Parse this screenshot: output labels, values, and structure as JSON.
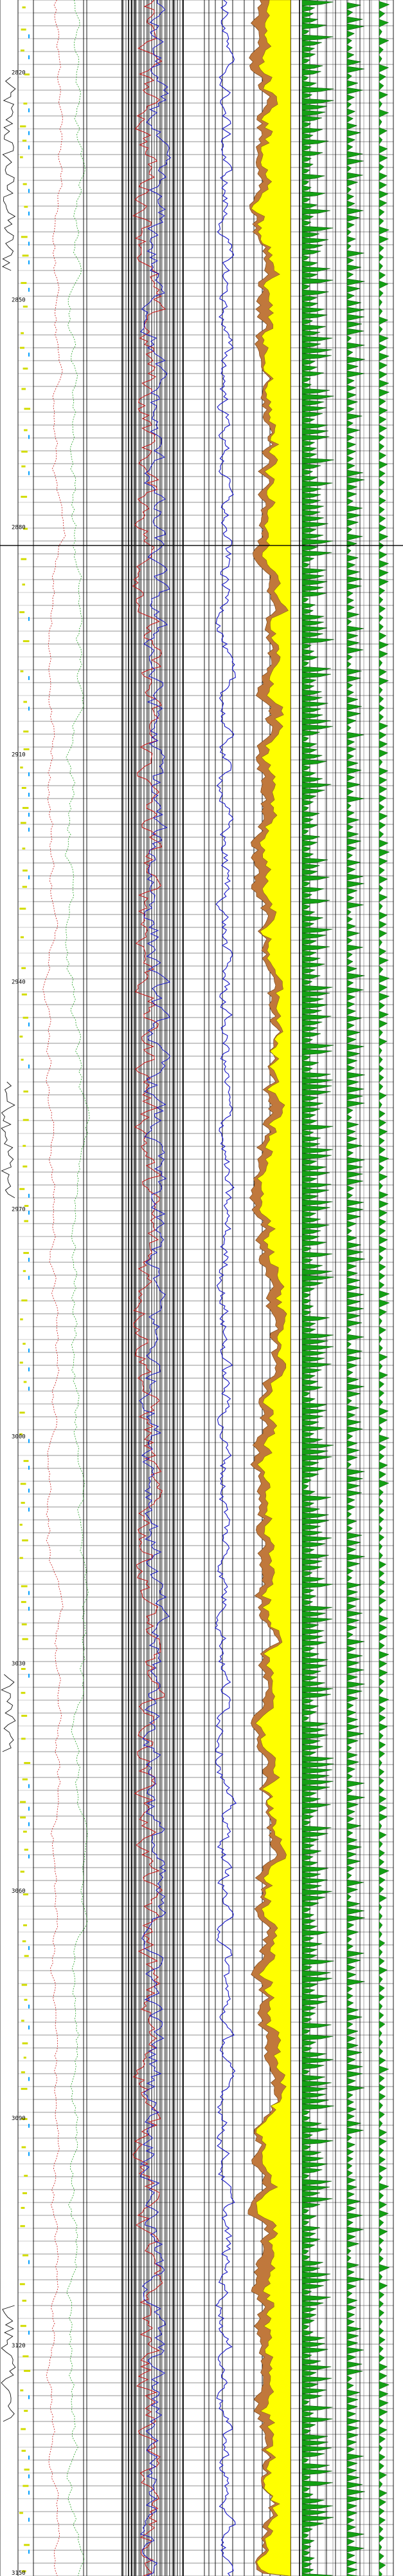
{
  "chart_data": {
    "type": "line",
    "title": "",
    "depth_axis": {
      "unit": "",
      "range": [
        2810,
        3150
      ],
      "labels": [
        {
          "value": 2820,
          "text": "2820"
        },
        {
          "value": 2850,
          "text": "2850"
        },
        {
          "value": 2880,
          "text": "2880"
        },
        {
          "value": 2910,
          "text": "2910"
        },
        {
          "value": 2940,
          "text": "2940"
        },
        {
          "value": 2970,
          "text": "2970"
        },
        {
          "value": 3000,
          "text": "3000"
        },
        {
          "value": 3030,
          "text": "3030"
        },
        {
          "value": 3060,
          "text": "3060"
        },
        {
          "value": 3090,
          "text": "3090"
        },
        {
          "value": 3120,
          "text": "3120"
        },
        {
          "value": 3150,
          "text": "3150"
        }
      ]
    },
    "tracks": [
      {
        "name": "",
        "kind": "depth-trace",
        "color": "#101010"
      },
      {
        "name": "",
        "kind": "markers",
        "colors": [
          "#c8c800",
          "#ffff00",
          "#00a0ff"
        ]
      },
      {
        "name": "",
        "kind": "curves",
        "colors": [
          "#d01010",
          "#10a010"
        ]
      },
      {
        "name": "",
        "kind": "resistivity",
        "colors": [
          "#d01010",
          "#1010d0",
          "#a01060"
        ]
      },
      {
        "name": "",
        "kind": "gamma",
        "color": "#0000c8"
      },
      {
        "name": "",
        "kind": "porosity-fill",
        "colors": [
          "#c0783c",
          "#ffff00"
        ]
      },
      {
        "name": "",
        "kind": "waveform",
        "color": "#008000"
      },
      {
        "name": "",
        "kind": "waveform-small",
        "color": "#008000"
      }
    ],
    "grid": true,
    "highlight_depth": 2882,
    "colors": {
      "fill_brown": "#c0783c",
      "fill_yellow": "#ffff00",
      "wave_green": "#14a014",
      "curve_blue": "#1414c8",
      "curve_red": "#c81414",
      "curve_green": "#1ea01e",
      "marker_yellow": "#d2dc00"
    }
  }
}
